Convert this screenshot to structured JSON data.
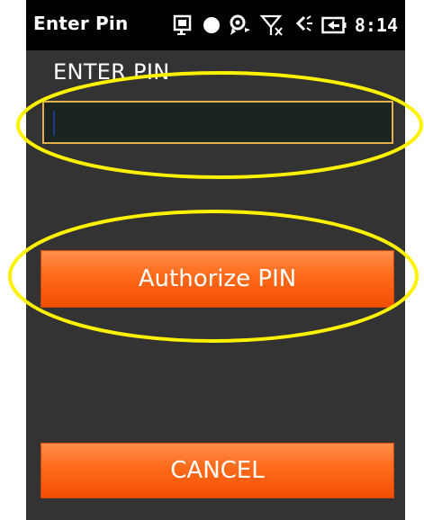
{
  "status_bar": {
    "title": "Enter Pin",
    "time": "8:14",
    "icons": [
      "notification-window-icon",
      "status-dot-icon",
      "sync-icon",
      "no-signal-icon",
      "volume-icon",
      "battery-icon"
    ]
  },
  "form": {
    "label": "ENTER PIN",
    "pin_value": ""
  },
  "buttons": {
    "authorize_label": "Authorize PIN",
    "cancel_label": "CANCEL"
  },
  "colors": {
    "background": "#333333",
    "status_bar": "#000000",
    "input_border": "#e3b24a",
    "button_orange": "#ff6a1a",
    "annotation": "#fff200"
  }
}
